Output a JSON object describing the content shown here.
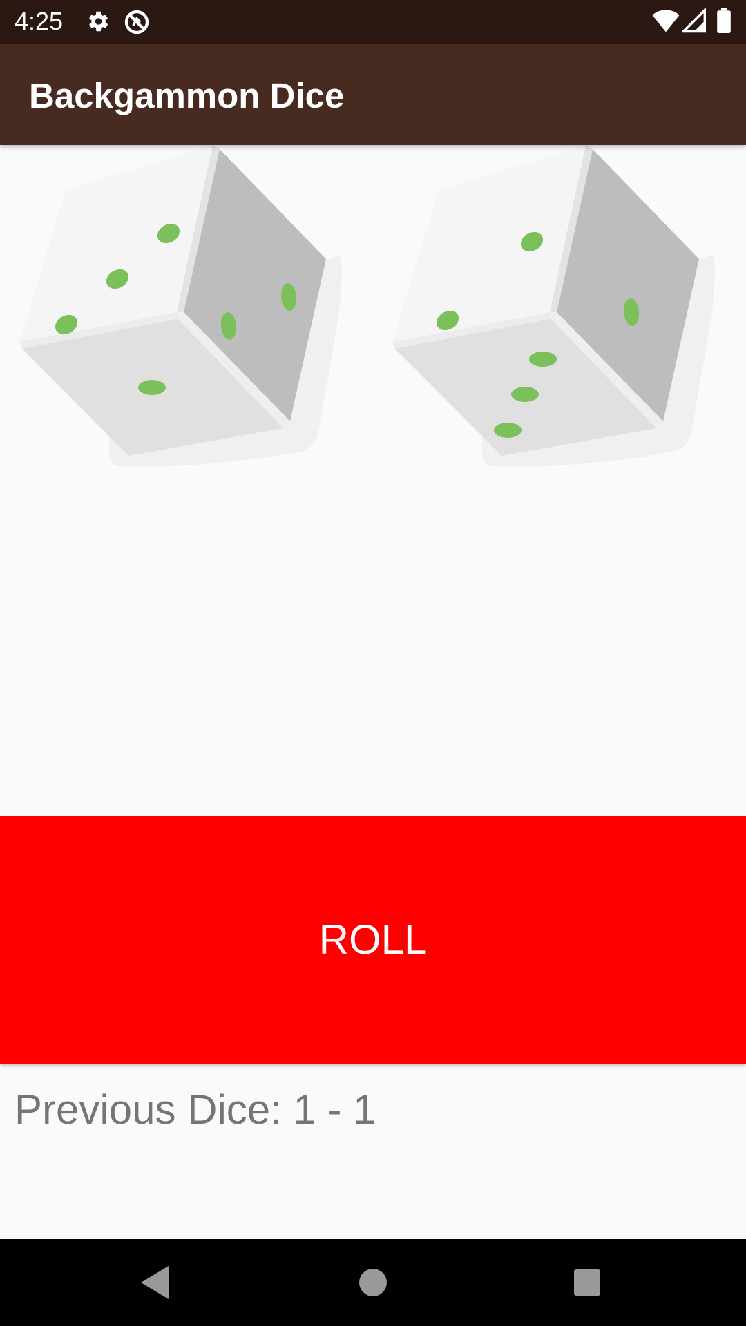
{
  "status_bar": {
    "time": "4:25",
    "icons": [
      "gear-icon",
      "data-saver-icon",
      "wifi-icon",
      "cellular-signal-icon",
      "battery-icon"
    ]
  },
  "app_bar": {
    "title": "Backgammon Dice",
    "background_color": "#482b20",
    "status_color": "#2c1812"
  },
  "dice": [
    {
      "name": "left-die",
      "top_face": 3,
      "right_face": 2,
      "front_face": 1
    },
    {
      "name": "right-die",
      "top_face": 2,
      "right_face": 1,
      "front_face": 3
    }
  ],
  "pip_color": "#7cc05c",
  "roll_button": {
    "label": "ROLL",
    "color": "#ff0000"
  },
  "previous_dice": {
    "text": "Previous Dice: 1 - 1"
  },
  "nav_bar": {
    "buttons": [
      "back-icon",
      "home-icon",
      "recents-icon"
    ]
  }
}
